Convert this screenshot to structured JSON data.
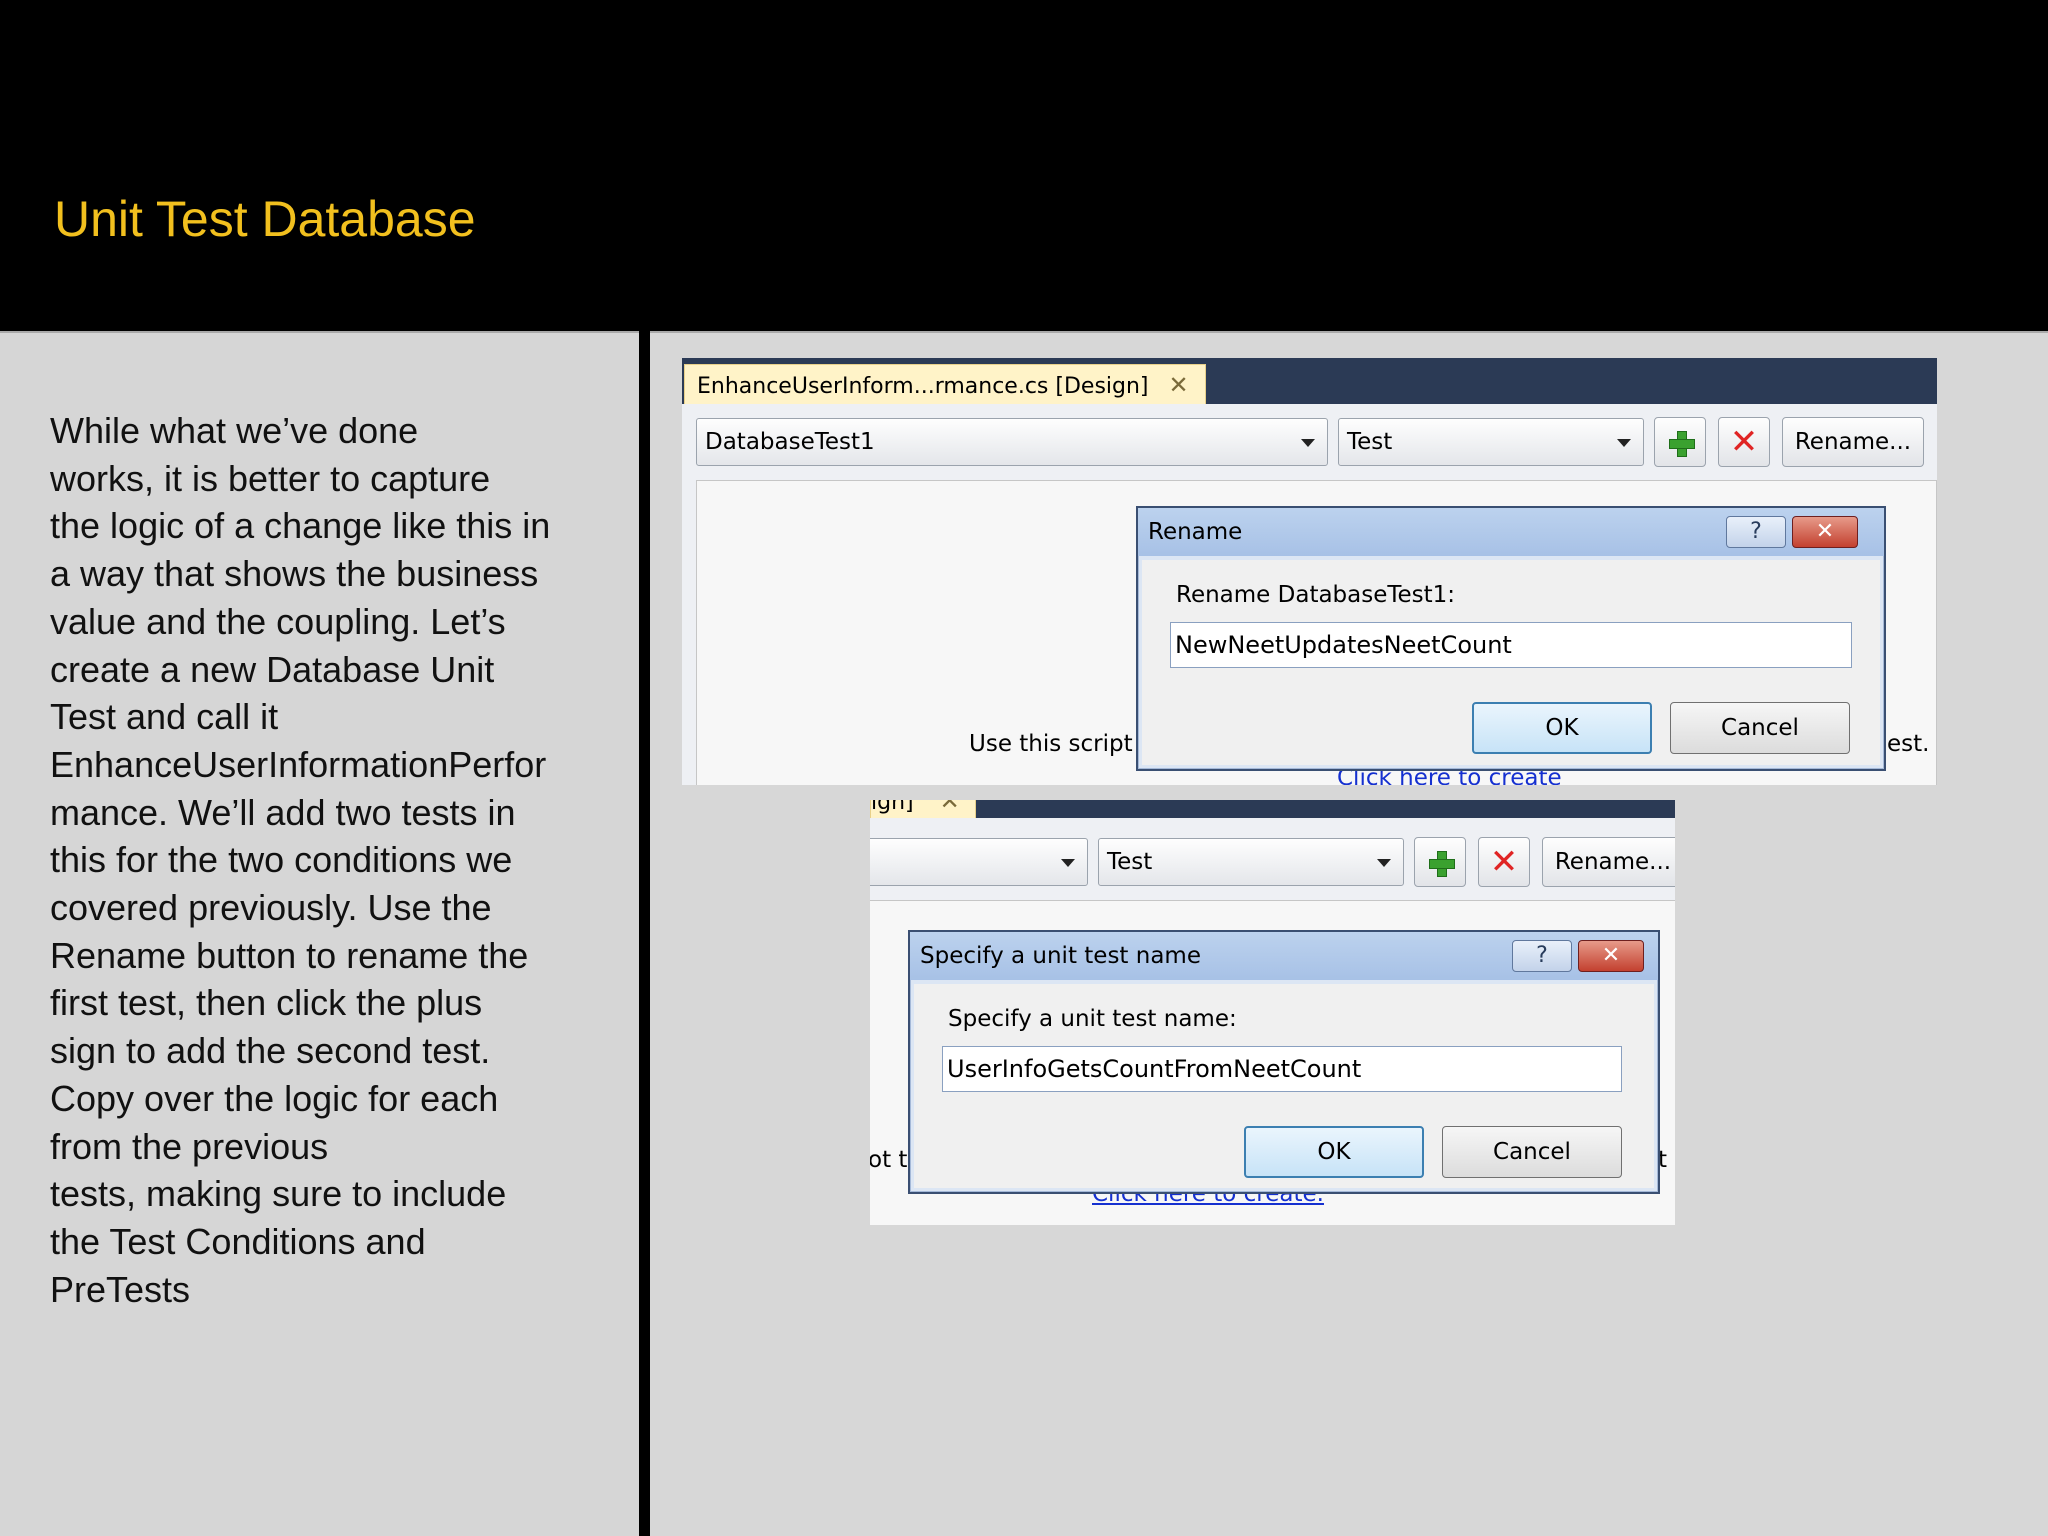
{
  "slide": {
    "title": "Unit Test Database",
    "body_lines": [
      "While what we’ve done",
      "works, it is better to capture",
      "the logic of a change like this in",
      "a way that shows the business",
      "value and the coupling. Let’s",
      "create a new Database Unit",
      "Test and call it",
      "EnhanceUserInformationPerfor",
      "mance. We’ll add two tests in",
      "this for the two conditions we",
      "covered previously. Use the",
      "Rename button to rename the",
      "first test, then click the plus",
      "sign to add the second test.",
      "Copy over the logic for each",
      "from the previous",
      "tests, making sure to include",
      "the Test Conditions and",
      "PreTests"
    ]
  },
  "screenshot1": {
    "tab_label": "EnhanceUserInform...rmance.cs [Design]",
    "tab_close": "✕",
    "test_combo_value": "DatabaseTest1",
    "type_combo_value": "Test",
    "add_icon": "plus-icon",
    "delete_icon": "red-x-icon",
    "delete_glyph": "✕",
    "rename_label": "Rename...",
    "background_text": "Use this script t",
    "background_text_right": "est.",
    "background_link": "Click here to create",
    "dialog": {
      "title": "Rename",
      "help": "?",
      "close": "✕",
      "prompt": "Rename DatabaseTest1:",
      "input_value": "NewNeetUpdatesNeetCount",
      "ok_label": "OK",
      "cancel_label": "Cancel"
    }
  },
  "screenshot2": {
    "tab_fragment": "ign]",
    "tab_close": "✕",
    "type_combo_value": "Test",
    "add_icon": "plus-icon",
    "delete_icon": "red-x-icon",
    "delete_glyph": "✕",
    "rename_label": "Rename...",
    "background_text_left": "ot to",
    "background_text_right": "t",
    "background_link": "Click here to create.",
    "dialog": {
      "title": "Specify a unit test name",
      "help": "?",
      "close": "✕",
      "prompt": "Specify a unit test name:",
      "input_value": "UserInfoGetsCountFromNeetCount",
      "ok_label": "OK",
      "cancel_label": "Cancel"
    }
  }
}
